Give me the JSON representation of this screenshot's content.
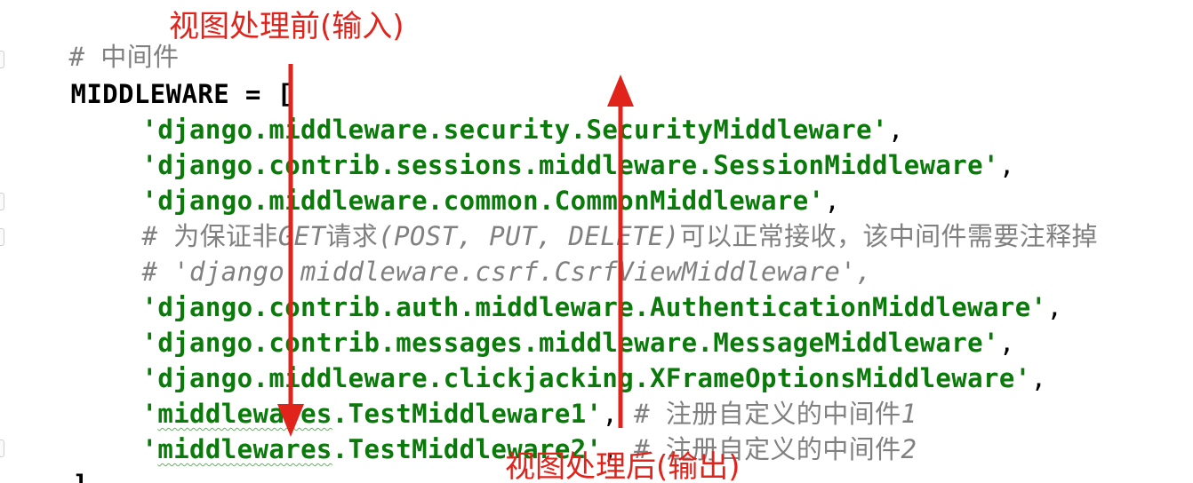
{
  "editor": {
    "lines": [
      {
        "id": "comment-middleware",
        "hash": "# ",
        "text": "中间件"
      },
      {
        "id": "decl",
        "name": "MIDDLEWARE",
        "op": " = ",
        "bracket": "["
      },
      {
        "id": "mw-security",
        "value": "'django.middleware.security.SecurityMiddleware'",
        "suffix": ","
      },
      {
        "id": "mw-sessions",
        "value": "'django.contrib.sessions.middleware.SessionMiddleware'",
        "suffix": ","
      },
      {
        "id": "mw-common",
        "value": "'django.middleware.common.CommonMiddleware'",
        "suffix": ","
      },
      {
        "id": "comment-csrf-note",
        "hash": "# ",
        "text_a": "为保证非",
        "text_b": "GET",
        "text_c": "请求",
        "text_d": "(POST, PUT, DELETE)",
        "text_e": "可以正常接收，该中间件需要注释掉"
      },
      {
        "id": "comment-csrf",
        "text": "# 'django.middleware.csrf.CsrfViewMiddleware',"
      },
      {
        "id": "mw-auth",
        "value": "'django.contrib.auth.middleware.AuthenticationMiddleware'",
        "suffix": ","
      },
      {
        "id": "mw-messages",
        "value": "'django.contrib.messages.middleware.MessageMiddleware'",
        "suffix": ","
      },
      {
        "id": "mw-clickjacking",
        "value": "'django.middleware.clickjacking.XFrameOptionsMiddleware'",
        "suffix": ","
      },
      {
        "id": "mw-test1",
        "q1": "'",
        "pkg": "middlewares",
        "rest": ".TestMiddleware1'",
        "suffix": ",",
        "comment_hash": " # ",
        "comment_text": "注册自定义的中间件",
        "comment_num": "1"
      },
      {
        "id": "mw-test2",
        "q1": "'",
        "pkg": "middlewares",
        "rest": ".TestMiddleware2'",
        "suffix": ",",
        "comment_hash": " # ",
        "comment_text": "注册自定义的中间件",
        "comment_num": "2"
      },
      {
        "id": "close",
        "bracket": "]"
      }
    ]
  },
  "annotations": {
    "request_label": "视图处理前(输入)",
    "response_label": "视图处理后(输出)"
  },
  "colors": {
    "string": "#0a7a0a",
    "comment": "#808080",
    "keyword": "#000000",
    "annotation": "#e0231b"
  }
}
